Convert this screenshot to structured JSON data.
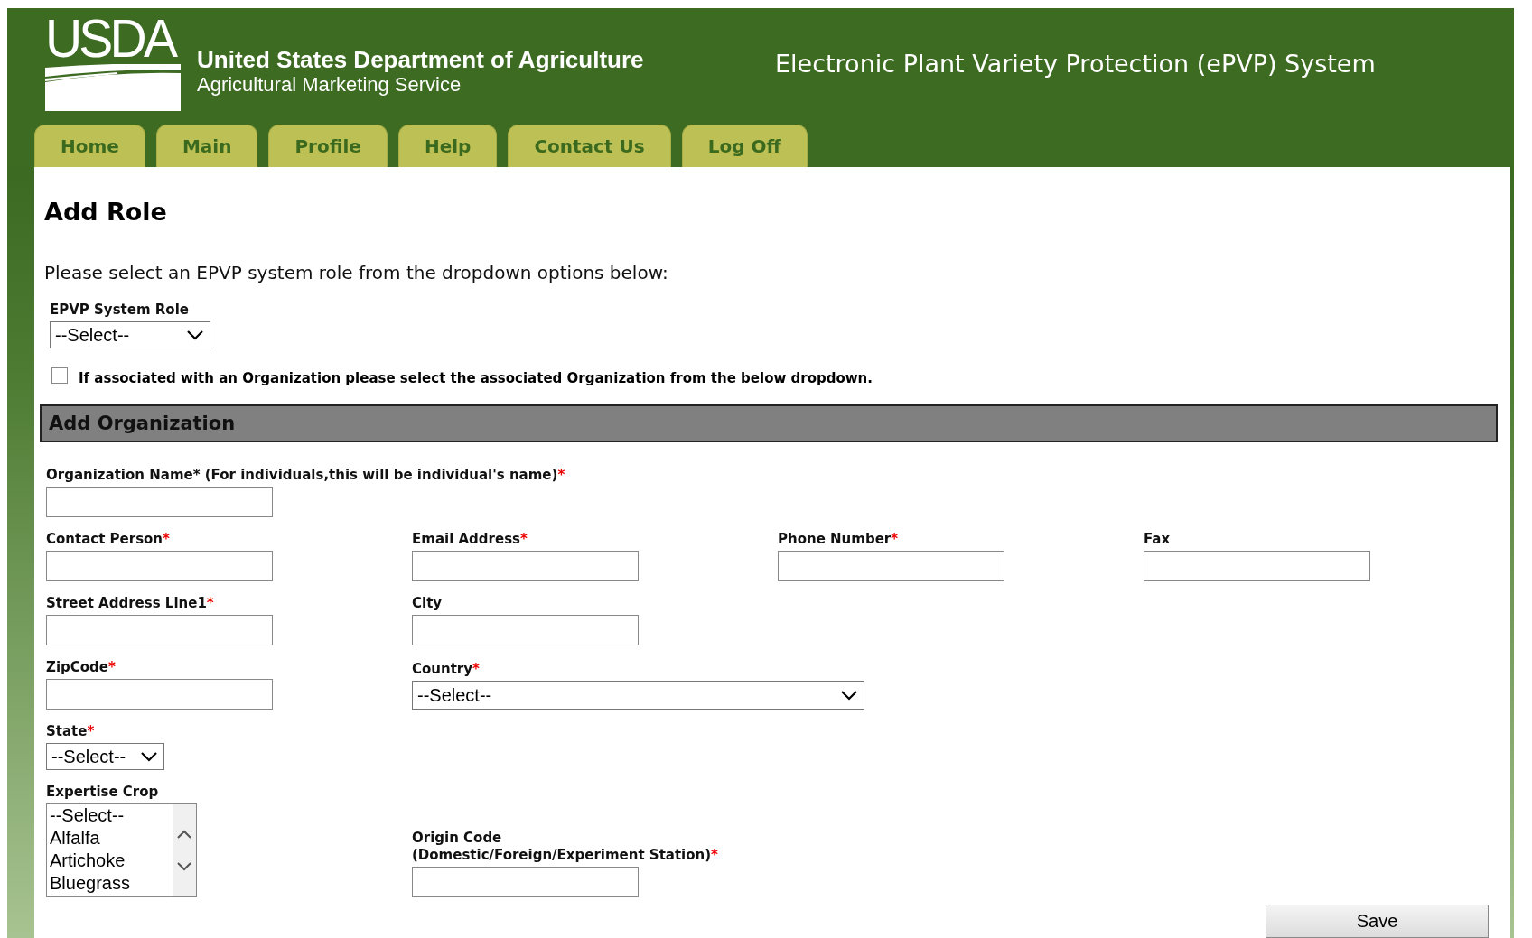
{
  "header": {
    "logo_text": "USDA",
    "agency": "United States Department of Agriculture",
    "service": "Agricultural Marketing Service",
    "system_title": "Electronic Plant Variety Protection (ePVP) System"
  },
  "tabs": [
    {
      "label": "Home",
      "selected": false
    },
    {
      "label": "Main",
      "selected": false
    },
    {
      "label": "Profile",
      "selected": false
    },
    {
      "label": "Help",
      "selected": false
    },
    {
      "label": "Contact Us",
      "selected": false
    },
    {
      "label": "Log Off",
      "selected": false
    }
  ],
  "page_title": "Add Role",
  "instruction": "Please select an EPVP system role from the dropdown options below:",
  "role_field": {
    "label": "EPVP System Role",
    "value": "--Select--"
  },
  "organization_checkbox": {
    "label": "If associated with an Organization please select the associated Organization from the below dropdown.",
    "checked": false
  },
  "section_title": "Add Organization",
  "form_rows": [
    [
      {
        "kind": "text",
        "label": "Organization Name* (For individuals,this will be individual's name)",
        "required_mark": "*"
      }
    ],
    [
      {
        "kind": "text",
        "label": "Contact Person",
        "required_mark": "*"
      },
      {
        "kind": "text",
        "label": "Email Address",
        "required_mark": "*"
      },
      {
        "kind": "text",
        "label": "Phone Number",
        "required_mark": "*"
      },
      {
        "kind": "text",
        "label": "Fax"
      }
    ],
    [
      {
        "kind": "text",
        "label": "Street Address Line1",
        "required_mark": "*"
      },
      {
        "kind": "text",
        "label": "City"
      }
    ],
    [
      {
        "kind": "text",
        "label": "ZipCode",
        "required_mark": "*"
      },
      {
        "kind": "select",
        "label": "Country",
        "required_mark": "*",
        "value": "--Select--"
      }
    ],
    [
      {
        "kind": "select",
        "label": "State",
        "required_mark": "*",
        "value": "--Select--"
      }
    ],
    [
      {
        "kind": "listbox",
        "label": "Expertise Crop",
        "options": [
          "--Select--",
          "Alfalfa",
          "Artichoke",
          "Bluegrass"
        ]
      },
      {
        "kind": "text",
        "label": "Origin Code",
        "label_line2": "(Domestic/Foreign/Experiment Station)",
        "required_mark": "*"
      }
    ]
  ],
  "save_button": "Save"
}
